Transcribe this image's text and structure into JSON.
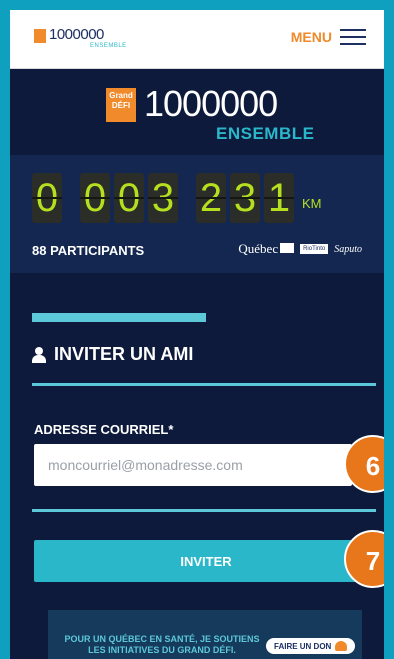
{
  "header": {
    "logo_number": "1000000",
    "logo_sub": "ENSEMBLE",
    "menu_label": "MENU"
  },
  "hero": {
    "badge_text": "Grand DÉFI",
    "number": "1000000",
    "sub": "ENSEMBLE"
  },
  "counter": {
    "digits": [
      "0",
      "0",
      "0",
      "3",
      "2",
      "3",
      "1"
    ],
    "unit": "KM",
    "participants": "88 PARTICIPANTS",
    "sponsors": {
      "quebec": "Québec",
      "riotinto": "RioTinto",
      "saputo": "Saputo"
    }
  },
  "invite": {
    "title": "INVITER UN AMI",
    "email_label": "ADRESSE COURRIEL*",
    "email_placeholder": "moncourriel@monadresse.com",
    "button_label": "INVITER"
  },
  "steps": {
    "step6": "6",
    "step7": "7"
  },
  "donate": {
    "text": "POUR UN QUÉBEC EN SANTÉ, JE SOUTIENS LES INITIATIVES DU GRAND DÉFI.",
    "button_label": "FAIRE UN DON"
  },
  "colors": {
    "background": "#0d1a3b",
    "accent": "#2ab7c9",
    "orange": "#e8761a",
    "digit_green": "#b6e01f"
  }
}
